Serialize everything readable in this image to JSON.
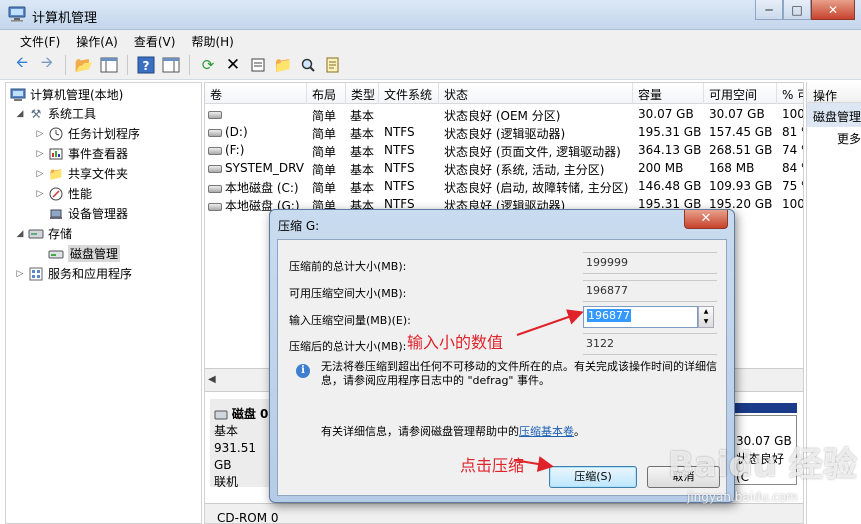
{
  "window": {
    "title": "计算机管理"
  },
  "menu": [
    "文件(F)",
    "操作(A)",
    "查看(V)",
    "帮助(H)"
  ],
  "toolbar_icons": [
    "back-arrow-icon",
    "forward-arrow-icon",
    "folder-up-icon",
    "console-tree-icon",
    "help-icon",
    "properties-pane-icon",
    "refresh-icon",
    "delete-icon",
    "properties-icon",
    "open-icon",
    "search-icon",
    "export-icon"
  ],
  "tree": {
    "root": "计算机管理(本地)",
    "system_tools": "系统工具",
    "task_scheduler": "任务计划程序",
    "event_viewer": "事件查看器",
    "shared_folders": "共享文件夹",
    "performance": "性能",
    "device_manager": "设备管理器",
    "storage": "存储",
    "disk_management": "磁盘管理",
    "services_apps": "服务和应用程序"
  },
  "volumes": {
    "columns": [
      "卷",
      "布局",
      "类型",
      "文件系统",
      "状态",
      "容量",
      "可用空间",
      "% 可"
    ],
    "rows": [
      {
        "name": "",
        "layout": "简单",
        "type": "基本",
        "fs": "",
        "status": "状态良好 (OEM 分区)",
        "capacity": "30.07 GB",
        "free": "30.07 GB",
        "pct": "100"
      },
      {
        "name": "(D:)",
        "layout": "简单",
        "type": "基本",
        "fs": "NTFS",
        "status": "状态良好 (逻辑驱动器)",
        "capacity": "195.31 GB",
        "free": "157.45 GB",
        "pct": "81 %"
      },
      {
        "name": "(F:)",
        "layout": "简单",
        "type": "基本",
        "fs": "NTFS",
        "status": "状态良好 (页面文件, 逻辑驱动器)",
        "capacity": "364.13 GB",
        "free": "268.51 GB",
        "pct": "74 %"
      },
      {
        "name": "SYSTEM_DRV",
        "layout": "简单",
        "type": "基本",
        "fs": "NTFS",
        "status": "状态良好 (系统, 活动, 主分区)",
        "capacity": "200 MB",
        "free": "168 MB",
        "pct": "84 %"
      },
      {
        "name": "本地磁盘 (C:)",
        "layout": "简单",
        "type": "基本",
        "fs": "NTFS",
        "status": "状态良好 (启动, 故障转储, 主分区)",
        "capacity": "146.48 GB",
        "free": "109.93 GB",
        "pct": "75 %"
      },
      {
        "name": "本地磁盘 (G:)",
        "layout": "简单",
        "type": "基本",
        "fs": "NTFS",
        "status": "状态良好 (逻辑驱动器)",
        "capacity": "195.31 GB",
        "free": "195.20 GB",
        "pct": "100"
      }
    ]
  },
  "disk0": {
    "name": "磁盘 0",
    "type": "基本",
    "size": "931.51 GB",
    "status": "联机",
    "partition_size": "30.07 GB",
    "partition_status": "状态良好 (C"
  },
  "cdrom": "CD-ROM 0",
  "actions": {
    "header": "操作",
    "selected": "磁盘管理",
    "more": "更多"
  },
  "dialog": {
    "title": "压缩 G:",
    "total_before_label": "压缩前的总计大小(MB):",
    "total_before_value": "199999",
    "available_label": "可用压缩空间大小(MB):",
    "available_value": "196877",
    "input_label": "输入压缩空间量(MB)(E):",
    "input_value": "196877",
    "total_after_label": "压缩后的总计大小(MB):",
    "total_after_value": "3122",
    "info_text": "无法将卷压缩到超出任何不可移动的文件所在的点。有关完成该操作时间的详细信息，请参阅应用程序日志中的 \"defrag\" 事件。",
    "help_prefix": "有关详细信息，请参阅磁盘管理帮助中的",
    "help_link": "压缩基本卷",
    "help_suffix": "。",
    "shrink_button": "压缩(S)",
    "cancel_button": "取消"
  },
  "annotations": {
    "input_hint": "输入小的数值",
    "click_hint": "点击压缩"
  },
  "watermark": {
    "logo": "Baidu 经验",
    "url": "jingyan.baidu.com"
  }
}
